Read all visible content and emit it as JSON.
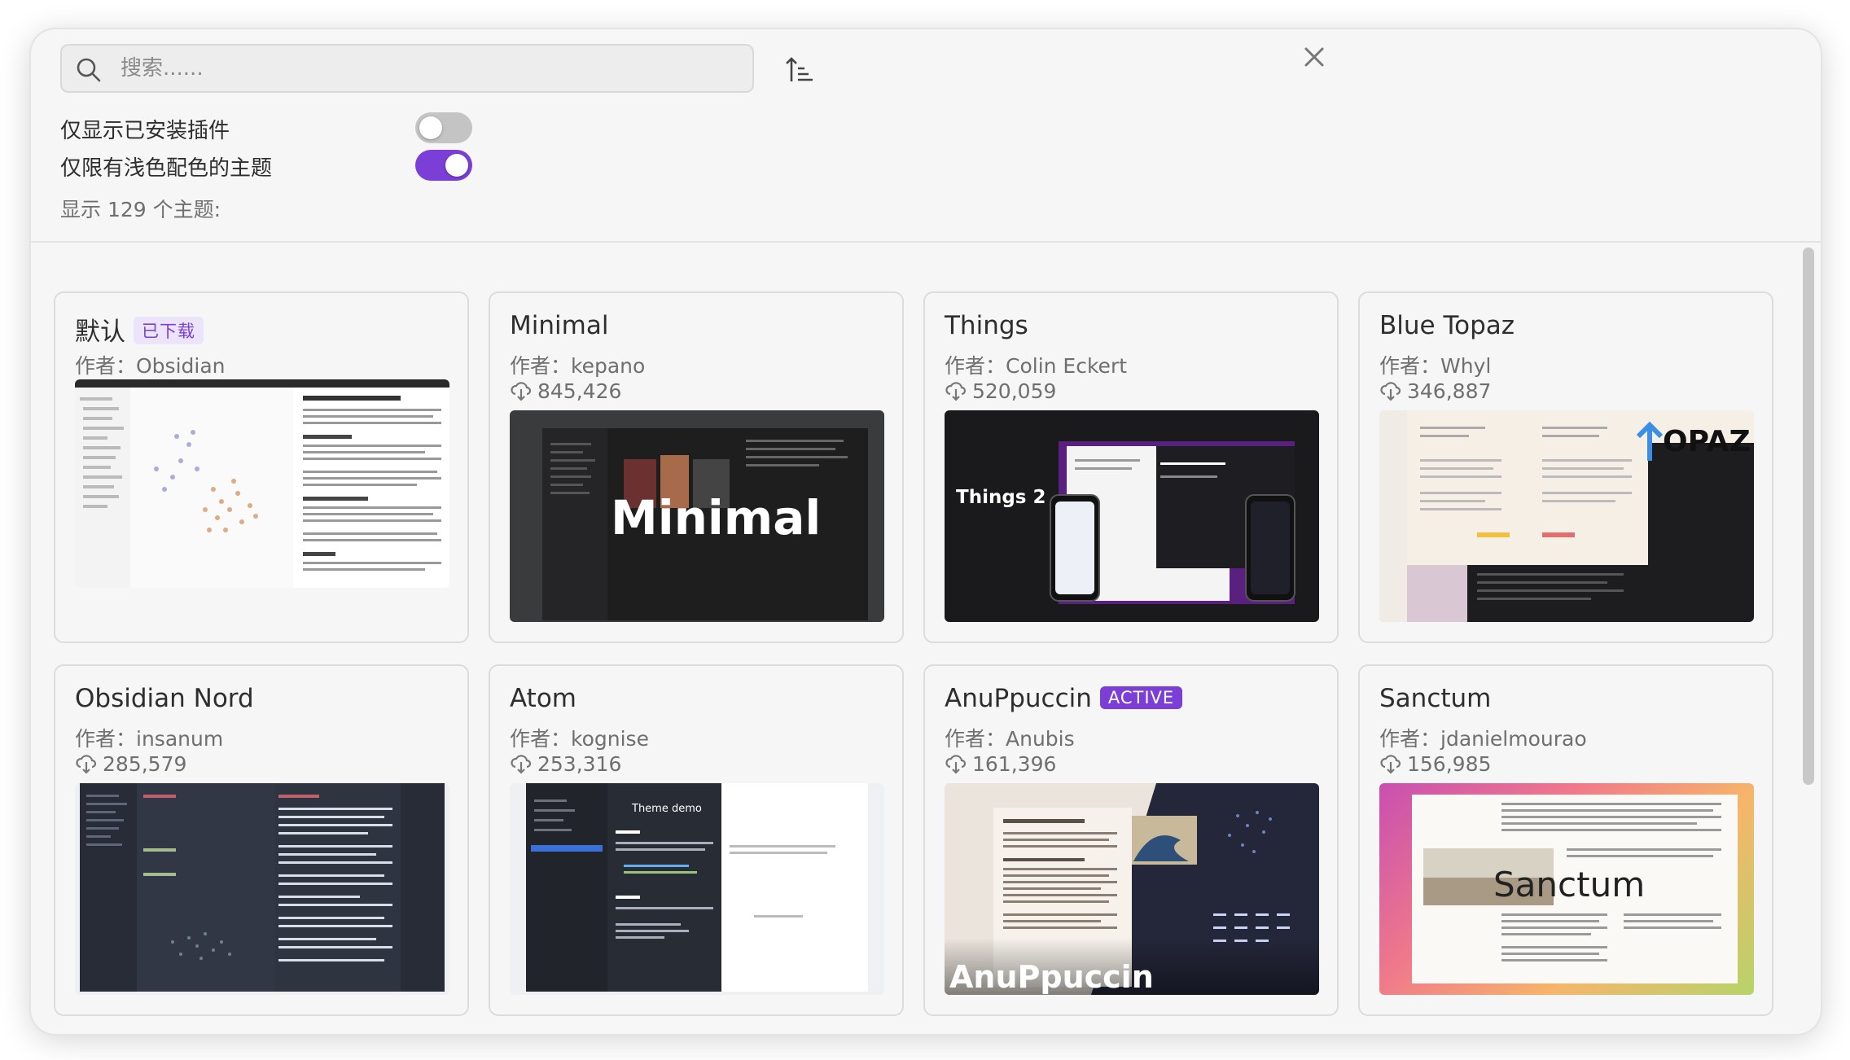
{
  "search": {
    "placeholder": "搜索......"
  },
  "filters": [
    {
      "label": "仅显示已安装插件",
      "state": "off"
    },
    {
      "label": "仅限有浅色配色的主题",
      "state": "on"
    }
  ],
  "count_text": "显示 129 个主题:",
  "icons": {
    "search": "search-icon",
    "sort": "sort-ascending-icon",
    "close": "close-icon",
    "download": "download-cloud-icon"
  },
  "colors": {
    "accent": "#7b3fd8",
    "toggle_off": "#c4c4c4"
  },
  "themes": [
    {
      "name": "默认",
      "badge": "已下载",
      "author": "作者：Obsidian",
      "downloads": "",
      "preview_text": ""
    },
    {
      "name": "Minimal",
      "badge": "",
      "author": "作者：kepano",
      "downloads": "845,426",
      "preview_text": "Minimal"
    },
    {
      "name": "Things",
      "badge": "",
      "author": "作者：Colin Eckert",
      "downloads": "520,059",
      "preview_text": "Things 2"
    },
    {
      "name": "Blue Topaz",
      "badge": "",
      "author": "作者：Whyl",
      "downloads": "346,887",
      "preview_text": "OPAZ"
    },
    {
      "name": "Obsidian Nord",
      "badge": "",
      "author": "作者：insanum",
      "downloads": "285,579",
      "preview_text": ""
    },
    {
      "name": "Atom",
      "badge": "",
      "author": "作者：kognise",
      "downloads": "253,316",
      "preview_text": "Theme demo"
    },
    {
      "name": "AnuPpuccin",
      "badge": "ACTIVE",
      "author": "作者：Anubis",
      "downloads": "161,396",
      "preview_text": "AnuPpuccin"
    },
    {
      "name": "Sanctum",
      "badge": "",
      "author": "作者：jdanielmourao",
      "downloads": "156,985",
      "preview_text": "Sanctum"
    }
  ]
}
